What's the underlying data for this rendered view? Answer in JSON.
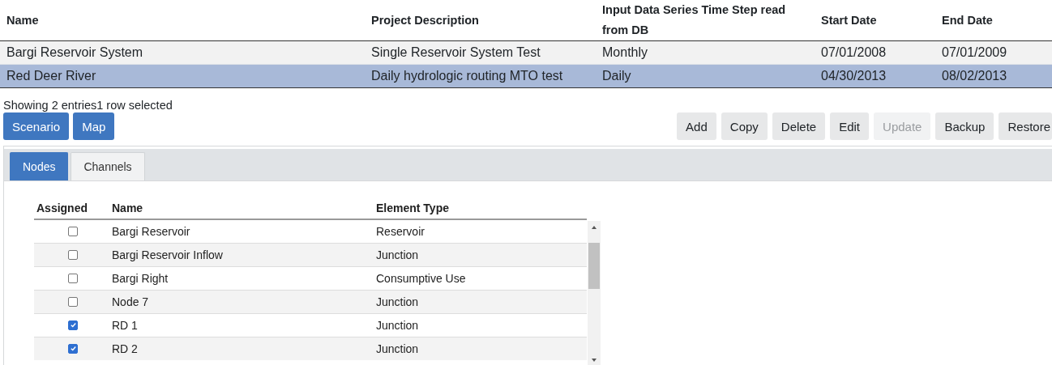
{
  "projects": {
    "columns": [
      "Name",
      "Project Description",
      "Input Data Series Time Step read from DB",
      "Start Date",
      "End Date"
    ],
    "rows": [
      {
        "cells": [
          "Bargi Reservoir System",
          "Single Reservoir System Test",
          "Monthly",
          "07/01/2008",
          "07/01/2009"
        ],
        "selected": false
      },
      {
        "cells": [
          "Red Deer River",
          "Daily hydrologic routing MTO test",
          "Daily",
          "04/30/2013",
          "08/02/2013"
        ],
        "selected": true
      }
    ]
  },
  "status": "Showing 2 entries1 row selected",
  "left_buttons": [
    {
      "label": "Scenario"
    },
    {
      "label": "Map"
    }
  ],
  "right_buttons": [
    {
      "label": "Add",
      "disabled": false
    },
    {
      "label": "Copy",
      "disabled": false
    },
    {
      "label": "Delete",
      "disabled": false
    },
    {
      "label": "Edit",
      "disabled": false
    },
    {
      "label": "Update",
      "disabled": true
    },
    {
      "label": "Backup",
      "disabled": false
    },
    {
      "label": "Restore",
      "disabled": false
    }
  ],
  "tabs": [
    {
      "label": "Nodes",
      "selected": true
    },
    {
      "label": "Channels",
      "selected": false
    }
  ],
  "elements": {
    "columns": [
      "Assigned",
      "Name",
      "Element Type"
    ],
    "rows": [
      {
        "assigned": false,
        "name": "Bargi Reservoir",
        "type": "Reservoir"
      },
      {
        "assigned": false,
        "name": "Bargi Reservoir Inflow",
        "type": "Junction"
      },
      {
        "assigned": false,
        "name": "Bargi Right",
        "type": "Consumptive Use"
      },
      {
        "assigned": false,
        "name": "Node 7",
        "type": "Junction"
      },
      {
        "assigned": true,
        "name": "RD 1",
        "type": "Junction"
      },
      {
        "assigned": true,
        "name": "RD 2",
        "type": "Junction"
      }
    ]
  }
}
